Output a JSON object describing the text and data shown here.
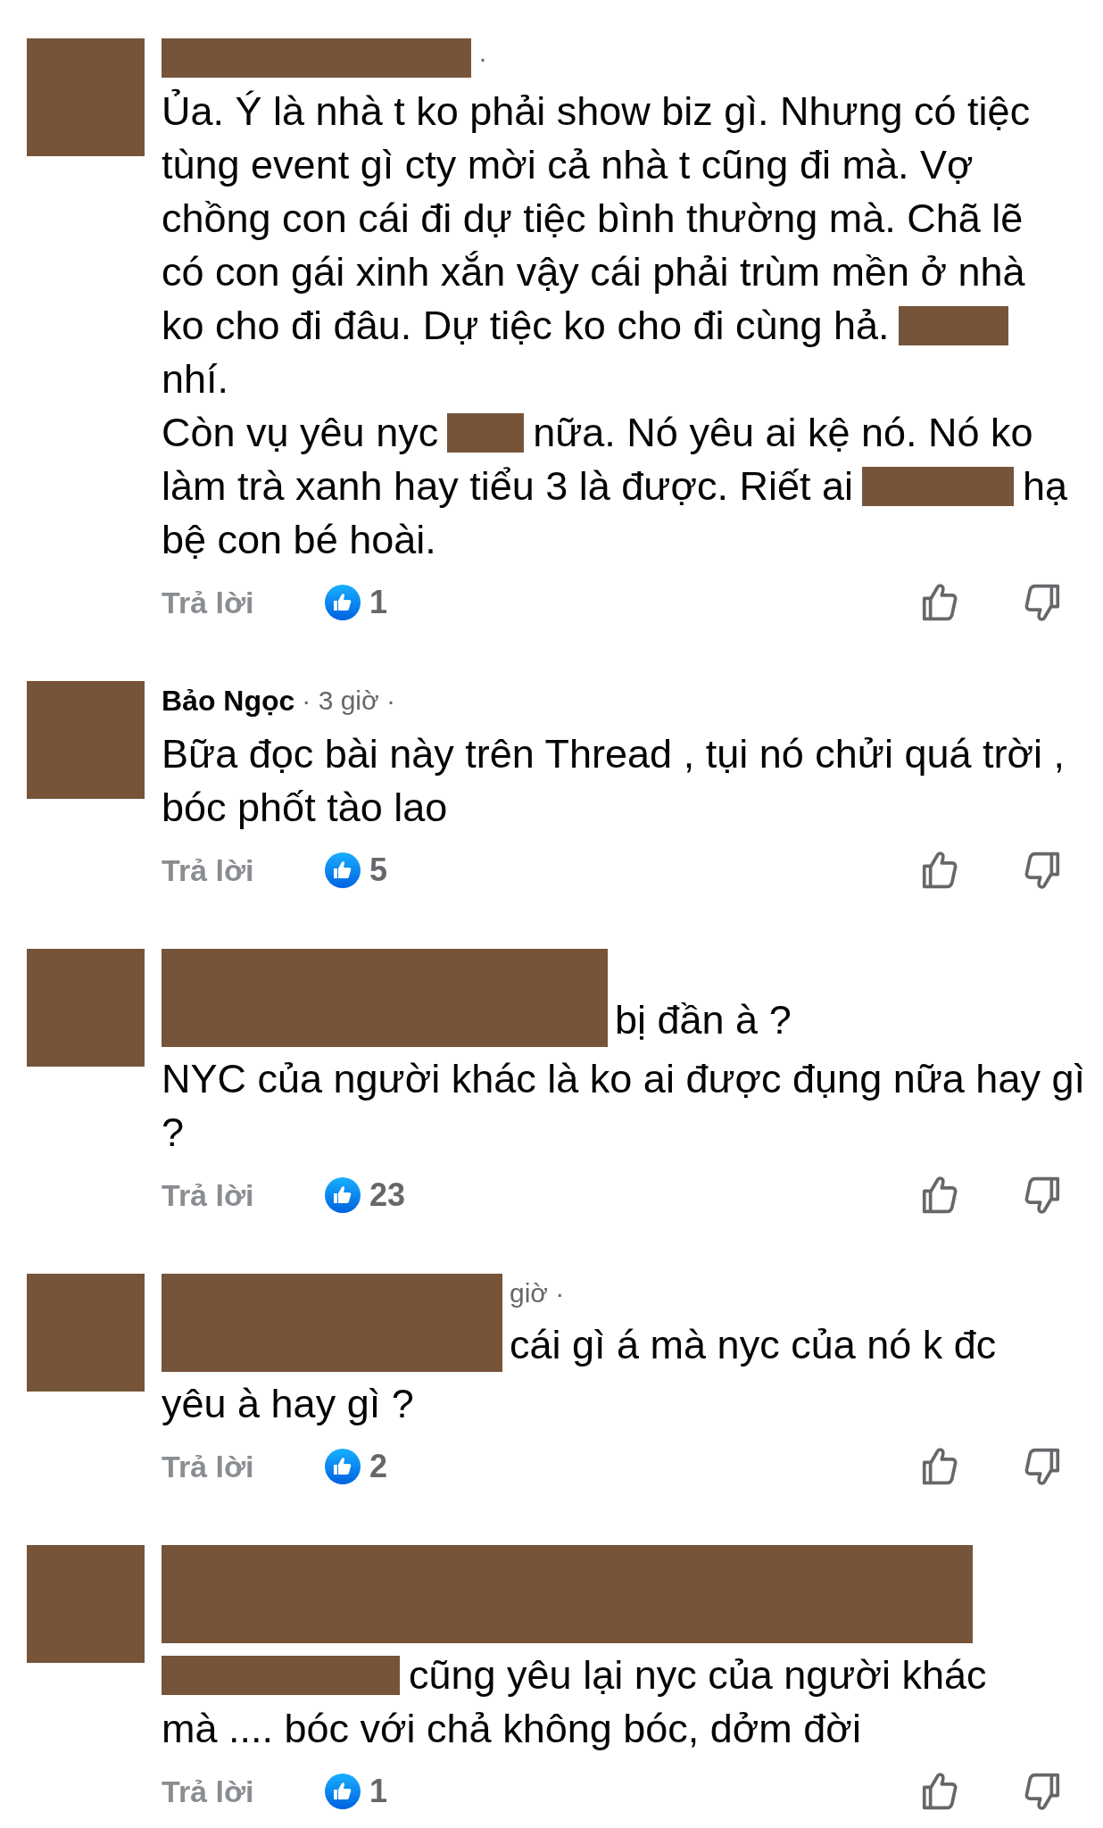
{
  "comments": [
    {
      "head": [
        {
          "kind": "redaction",
          "tall": false
        },
        {
          "kind": "meta",
          "text": "·"
        }
      ],
      "body": [
        [
          {
            "kind": "text",
            "text": "Ủa. Ý là nhà t ko phải show biz gì. Nhưng có tiệc"
          }
        ],
        [
          {
            "kind": "text",
            "text": "tùng event gì cty mời cả nhà t cũng đi mà. Vợ"
          }
        ],
        [
          {
            "kind": "text",
            "text": "chồng con cái đi dự tiệc bình thường mà. Chã lẽ"
          }
        ],
        [
          {
            "kind": "text",
            "text": "có con gái xinh xắn vậy cái phải trùm mền ở nhà"
          }
        ],
        [
          {
            "kind": "text",
            "text": "ko cho đi đâu. Dự tiệc ko cho đi cùng hả."
          },
          {
            "kind": "redaction",
            "tall": false
          }
        ],
        [
          {
            "kind": "text",
            "text": "nhí."
          }
        ],
        [
          {
            "kind": "text",
            "text": "Còn vụ yêu nyc"
          },
          {
            "kind": "redaction",
            "tall": false
          },
          {
            "kind": "text",
            "text": "nữa. Nó yêu ai kệ nó. Nó ko"
          }
        ],
        [
          {
            "kind": "text",
            "text": "làm trà xanh hay tiểu 3 là được. Riết ai"
          },
          {
            "kind": "redaction",
            "tall": false
          },
          {
            "kind": "text",
            "text": "hạ"
          }
        ],
        [
          {
            "kind": "text",
            "text": "bệ con bé hoài."
          }
        ]
      ],
      "reply": "Trả lời",
      "likes": "1"
    },
    {
      "head": [
        {
          "kind": "name",
          "text": "Bảo Ngọc"
        },
        {
          "kind": "meta",
          "text": "· 3 giờ ·"
        }
      ],
      "body": [
        [
          {
            "kind": "text",
            "text": "Bữa đọc bài này trên Thread , tụi nó chửi quá trời ,"
          }
        ],
        [
          {
            "kind": "text",
            "text": "bóc phốt tào lao"
          }
        ]
      ],
      "reply": "Trả lời",
      "likes": "5"
    },
    {
      "head": [
        {
          "kind": "redaction",
          "tall": true
        },
        {
          "kind": "text",
          "text": "bị đần à ?"
        }
      ],
      "body": [
        [
          {
            "kind": "text",
            "text": "NYC của người khác là ko ai được đụng nữa hay gì"
          }
        ],
        [
          {
            "kind": "text",
            "text": "?"
          }
        ]
      ],
      "reply": "Trả lời",
      "likes": "23"
    },
    {
      "head": [
        {
          "kind": "redaction",
          "tall": true
        },
        {
          "kind": "meta",
          "text": "giờ ·"
        },
        {
          "kind": "text",
          "text": "cái gì á mà nyc của nó k đc"
        }
      ],
      "body": [
        [
          {
            "kind": "text",
            "text": "yêu à hay gì ?"
          }
        ]
      ],
      "reply": "Trả lời",
      "likes": "2"
    },
    {
      "head": [
        {
          "kind": "redaction",
          "tall": true
        }
      ],
      "body": [
        [
          {
            "kind": "redaction",
            "tall": false
          },
          {
            "kind": "text",
            "text": "cũng yêu lại nyc của người khác"
          }
        ],
        [
          {
            "kind": "text",
            "text": "mà .... bóc với chả không bóc, dởm đời"
          }
        ]
      ],
      "reply": "Trả lời",
      "likes": "1"
    }
  ]
}
